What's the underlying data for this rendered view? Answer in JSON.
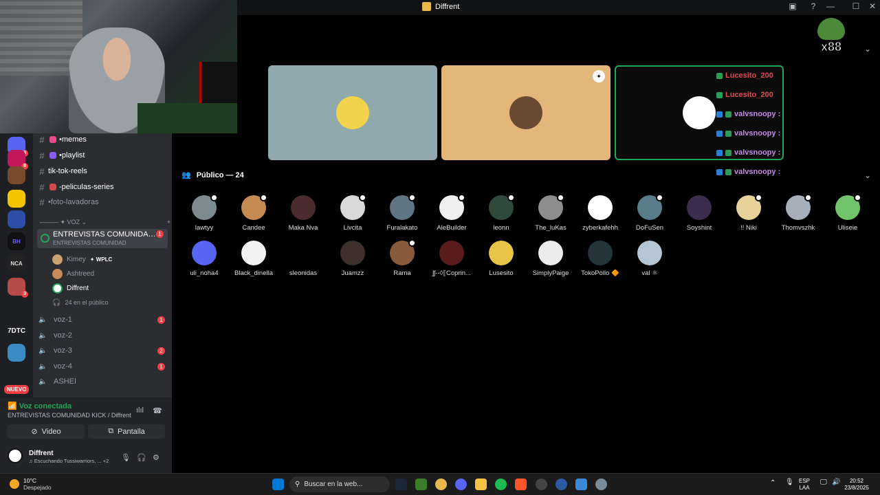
{
  "window": {
    "title": "Diffrent",
    "minimize": "—",
    "maximize": "☐",
    "close": "✕"
  },
  "guilds": {
    "nuevo_label": "NUEVO",
    "badges": [
      "8",
      "8",
      "3"
    ],
    "text_labels": [
      "7DTC",
      "BH",
      "NCA"
    ]
  },
  "channels": {
    "text": [
      {
        "label": "memes",
        "prefix": "• "
      },
      {
        "label": "playlist",
        "prefix": "• "
      },
      {
        "label": "tik-tok-reels",
        "prefix": ""
      },
      {
        "label": "-peliculas-series",
        "prefix": ""
      },
      {
        "label": "foto-lavadoras",
        "prefix": "• "
      }
    ],
    "category_label": "——— ✦ VOZ ⌄",
    "category_add": "+",
    "voice_active": {
      "name": "ENTREVISTAS COMUNIDAD K...",
      "sub": "ENTREVISTAS COMUNIDAD",
      "badge": "1"
    },
    "voice_users": [
      {
        "name": "Kimey",
        "tag": "✦ WPLC"
      },
      {
        "name": "Ashtreed",
        "tag": ""
      },
      {
        "name": "Diffrent",
        "tag": ""
      }
    ],
    "audience_count": "24 en el público",
    "voice_channels": [
      {
        "name": "voz-1",
        "badge": "1"
      },
      {
        "name": "voz-2",
        "badge": ""
      },
      {
        "name": "voz-3",
        "badge": "2"
      },
      {
        "name": "voz-4",
        "badge": "1"
      },
      {
        "name": "ASHEI",
        "badge": ""
      }
    ]
  },
  "voice_panel": {
    "status": "Voz conectada",
    "path": "ENTREVISTAS COMUNIDAD KICK / Diffrent",
    "video_label": "Video",
    "screen_label": "Pantalla"
  },
  "user_panel": {
    "name": "Diffrent",
    "status": "♫ Escuchando Tussiwarriors, ...  +2"
  },
  "overlay": {
    "emote_count": "x88",
    "chat": [
      {
        "user": "Lucesito_200",
        "color": "#e8484f"
      },
      {
        "user": "Lucesito_200",
        "color": "#e8484f"
      },
      {
        "user": "valvsnoopy :",
        "color": "#c78ae8"
      },
      {
        "user": "valvsnoopy :",
        "color": "#c78ae8"
      },
      {
        "user": "valvsnoopy :",
        "color": "#c78ae8"
      },
      {
        "user": "valvsnoopy :",
        "color": "#c78ae8"
      }
    ]
  },
  "audience": {
    "header": "Público — 24",
    "members": [
      {
        "name": "lawtyy",
        "color": "#7d8a8f",
        "dot": true
      },
      {
        "name": "Candee",
        "color": "#c58a52",
        "dot": true
      },
      {
        "name": "Maka Nva",
        "color": "#4a2c2e",
        "dot": false
      },
      {
        "name": "Livcita",
        "color": "#d9d9d9",
        "dot": true
      },
      {
        "name": "Furalakato",
        "color": "#5f7583",
        "dot": true
      },
      {
        "name": "AleBuilder",
        "color": "#f0f0f0",
        "dot": true
      },
      {
        "name": "leonn",
        "color": "#2f4a3c",
        "dot": true
      },
      {
        "name": "The_luKas",
        "color": "#8d8d8d",
        "dot": true
      },
      {
        "name": "zyberkafehh",
        "color": "#ffffff",
        "dot": false
      },
      {
        "name": "DoFuSen",
        "color": "#5a7d8c",
        "dot": true
      },
      {
        "name": "Soyshint",
        "color": "#3c2d4f",
        "dot": false
      },
      {
        "name": "!! Niki",
        "color": "#e6d29a",
        "dot": true
      },
      {
        "name": "Thomvszhk",
        "color": "#a6b0ba",
        "dot": true
      },
      {
        "name": "Uliseie",
        "color": "#6fc36b",
        "dot": true
      },
      {
        "name": "uli_noha4",
        "color": "#5865f2",
        "dot": false
      },
      {
        "name": "Black_dinella",
        "color": "#f2f2f2",
        "dot": false
      },
      {
        "name": "sleonidas",
        "color": "#000000",
        "dot": false
      },
      {
        "name": "Juamzz",
        "color": "#3e2f2b",
        "dot": false
      },
      {
        "name": "Rama",
        "color": "#8a5a3c",
        "dot": true
      },
      {
        "name": "ʃʃ--◊⟦Coprin...",
        "color": "#5a1c1c",
        "dot": false
      },
      {
        "name": "Lusesito",
        "color": "#e8c547",
        "dot": false
      },
      {
        "name": "SimplyPaige",
        "color": "#ececec",
        "dot": false
      },
      {
        "name": "TokoPollo 🔶",
        "color": "#26353b",
        "dot": false
      },
      {
        "name": "val ⚛",
        "color": "#b6c5d4",
        "dot": false
      }
    ]
  },
  "taskbar": {
    "weather_temp": "10°C",
    "weather_text": "Despejado",
    "search_placeholder": "Buscar en la web...",
    "lang1": "ESP",
    "lang2": "LAA",
    "time": "20:52",
    "date": "23/8/2025"
  }
}
